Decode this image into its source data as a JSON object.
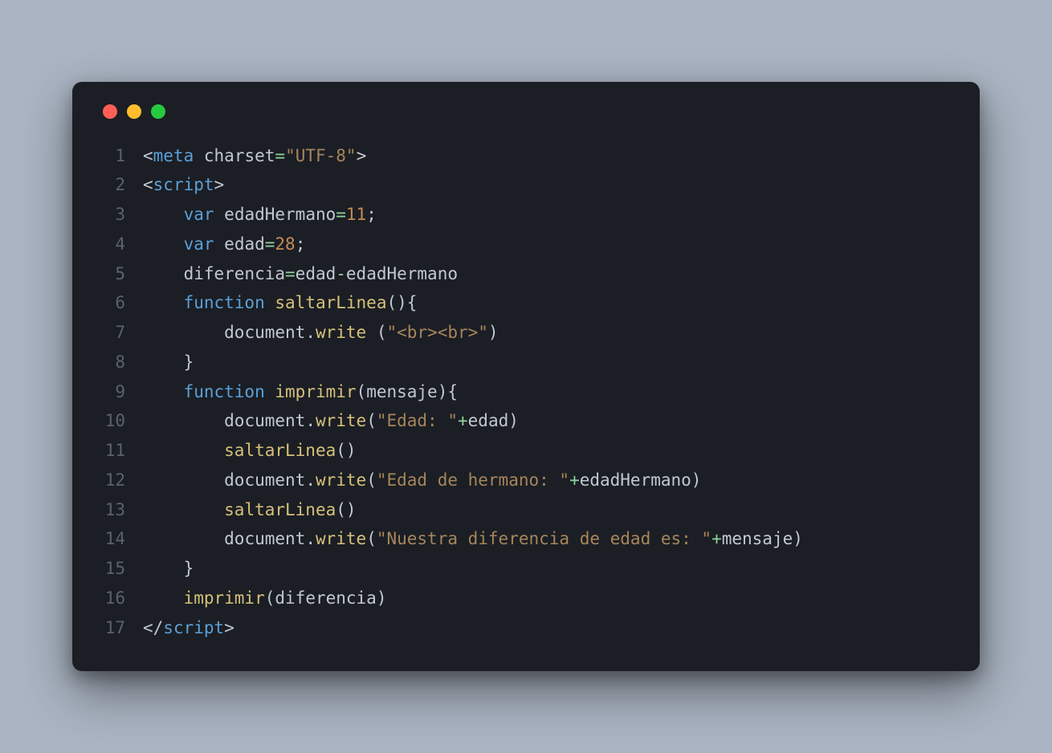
{
  "window": {
    "dots": [
      "red",
      "yellow",
      "green"
    ]
  },
  "code": {
    "lines": [
      {
        "num": "1",
        "tokens": [
          {
            "c": "p",
            "t": "<"
          },
          {
            "c": "tg",
            "t": "meta"
          },
          {
            "c": "p",
            "t": " "
          },
          {
            "c": "at",
            "t": "charset"
          },
          {
            "c": "op",
            "t": "="
          },
          {
            "c": "st",
            "t": "\"UTF-8\""
          },
          {
            "c": "p",
            "t": ">"
          }
        ]
      },
      {
        "num": "2",
        "tokens": [
          {
            "c": "p",
            "t": "<"
          },
          {
            "c": "tg",
            "t": "script"
          },
          {
            "c": "p",
            "t": ">"
          }
        ]
      },
      {
        "num": "3",
        "tokens": [
          {
            "c": "p",
            "t": "    "
          },
          {
            "c": "kw",
            "t": "var"
          },
          {
            "c": "p",
            "t": " "
          },
          {
            "c": "id",
            "t": "edadHermano"
          },
          {
            "c": "op",
            "t": "="
          },
          {
            "c": "nu",
            "t": "11"
          },
          {
            "c": "p",
            "t": ";"
          }
        ]
      },
      {
        "num": "4",
        "tokens": [
          {
            "c": "p",
            "t": "    "
          },
          {
            "c": "kw",
            "t": "var"
          },
          {
            "c": "p",
            "t": " "
          },
          {
            "c": "id",
            "t": "edad"
          },
          {
            "c": "op",
            "t": "="
          },
          {
            "c": "nu",
            "t": "28"
          },
          {
            "c": "p",
            "t": ";"
          }
        ]
      },
      {
        "num": "5",
        "tokens": [
          {
            "c": "p",
            "t": "    "
          },
          {
            "c": "id",
            "t": "diferencia"
          },
          {
            "c": "op",
            "t": "="
          },
          {
            "c": "id",
            "t": "edad"
          },
          {
            "c": "op",
            "t": "-"
          },
          {
            "c": "id",
            "t": "edadHermano"
          }
        ]
      },
      {
        "num": "6",
        "tokens": [
          {
            "c": "p",
            "t": "    "
          },
          {
            "c": "kw",
            "t": "function"
          },
          {
            "c": "p",
            "t": " "
          },
          {
            "c": "fn",
            "t": "saltarLinea"
          },
          {
            "c": "p",
            "t": "(){"
          }
        ]
      },
      {
        "num": "7",
        "tokens": [
          {
            "c": "p",
            "t": "        "
          },
          {
            "c": "id",
            "t": "document"
          },
          {
            "c": "p",
            "t": "."
          },
          {
            "c": "fn",
            "t": "write"
          },
          {
            "c": "p",
            "t": " ("
          },
          {
            "c": "st",
            "t": "\"<br><br>\""
          },
          {
            "c": "p",
            "t": ")"
          }
        ]
      },
      {
        "num": "8",
        "tokens": [
          {
            "c": "p",
            "t": "    }"
          }
        ]
      },
      {
        "num": "9",
        "tokens": [
          {
            "c": "p",
            "t": "    "
          },
          {
            "c": "kw",
            "t": "function"
          },
          {
            "c": "p",
            "t": " "
          },
          {
            "c": "fn",
            "t": "imprimir"
          },
          {
            "c": "p",
            "t": "("
          },
          {
            "c": "id",
            "t": "mensaje"
          },
          {
            "c": "p",
            "t": "){"
          }
        ]
      },
      {
        "num": "10",
        "tokens": [
          {
            "c": "p",
            "t": "        "
          },
          {
            "c": "id",
            "t": "document"
          },
          {
            "c": "p",
            "t": "."
          },
          {
            "c": "fn",
            "t": "write"
          },
          {
            "c": "p",
            "t": "("
          },
          {
            "c": "st",
            "t": "\"Edad: \""
          },
          {
            "c": "op",
            "t": "+"
          },
          {
            "c": "id",
            "t": "edad"
          },
          {
            "c": "p",
            "t": ")"
          }
        ]
      },
      {
        "num": "11",
        "tokens": [
          {
            "c": "p",
            "t": "        "
          },
          {
            "c": "fn",
            "t": "saltarLinea"
          },
          {
            "c": "p",
            "t": "()"
          }
        ]
      },
      {
        "num": "12",
        "tokens": [
          {
            "c": "p",
            "t": "        "
          },
          {
            "c": "id",
            "t": "document"
          },
          {
            "c": "p",
            "t": "."
          },
          {
            "c": "fn",
            "t": "write"
          },
          {
            "c": "p",
            "t": "("
          },
          {
            "c": "st",
            "t": "\"Edad de hermano: \""
          },
          {
            "c": "op",
            "t": "+"
          },
          {
            "c": "id",
            "t": "edadHermano"
          },
          {
            "c": "p",
            "t": ")"
          }
        ]
      },
      {
        "num": "13",
        "tokens": [
          {
            "c": "p",
            "t": "        "
          },
          {
            "c": "fn",
            "t": "saltarLinea"
          },
          {
            "c": "p",
            "t": "()"
          }
        ]
      },
      {
        "num": "14",
        "tokens": [
          {
            "c": "p",
            "t": "        "
          },
          {
            "c": "id",
            "t": "document"
          },
          {
            "c": "p",
            "t": "."
          },
          {
            "c": "fn",
            "t": "write"
          },
          {
            "c": "p",
            "t": "("
          },
          {
            "c": "st",
            "t": "\"Nuestra diferencia de edad es: \""
          },
          {
            "c": "op",
            "t": "+"
          },
          {
            "c": "id",
            "t": "mensaje"
          },
          {
            "c": "p",
            "t": ")"
          }
        ]
      },
      {
        "num": "15",
        "tokens": [
          {
            "c": "p",
            "t": "    }"
          }
        ]
      },
      {
        "num": "16",
        "tokens": [
          {
            "c": "p",
            "t": "    "
          },
          {
            "c": "fn",
            "t": "imprimir"
          },
          {
            "c": "p",
            "t": "("
          },
          {
            "c": "id",
            "t": "diferencia"
          },
          {
            "c": "p",
            "t": ")"
          }
        ]
      },
      {
        "num": "17",
        "tokens": [
          {
            "c": "p",
            "t": "</"
          },
          {
            "c": "tg",
            "t": "script"
          },
          {
            "c": "p",
            "t": ">"
          }
        ]
      }
    ]
  }
}
